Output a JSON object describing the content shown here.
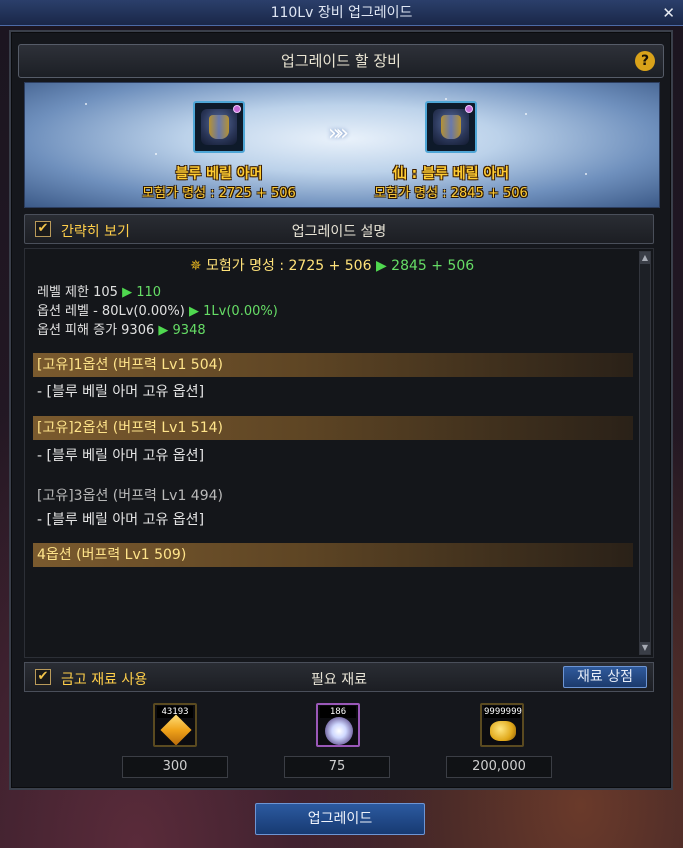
{
  "window": {
    "title": "110Lv 장비 업그레이드",
    "close_symbol": "✕"
  },
  "header": {
    "title": "업그레이드 할 장비",
    "help_symbol": "?"
  },
  "items": {
    "before": {
      "name": "블루 베릴 아머",
      "fame": "모험가 명성 : 2725 + 506"
    },
    "after": {
      "name": "仙 : 블루 베릴 아머",
      "fame": "모험가 명성 : 2845 + 506"
    },
    "arrow": "»»"
  },
  "description": {
    "checkbox_label": "간략히 보기",
    "checkbox_checked": true,
    "title": "업그레이드 설명",
    "fame_line": {
      "icon": "✵",
      "label": "모험가 명성 : 2725 + 506",
      "arrow": "▶",
      "new": "2845 + 506"
    },
    "stats": [
      {
        "label": "레벨 제한 105",
        "arrow": "▶",
        "new": "110"
      },
      {
        "label": "옵션 레벨 - 80Lv(0.00%)",
        "arrow": "▶",
        "new": "1Lv(0.00%)"
      },
      {
        "label": "옵션 피해 증가 9306",
        "arrow": "▶",
        "new": "9348"
      }
    ],
    "options": [
      {
        "title": "[고유]1옵션 (버프력 Lv1 504)",
        "sub": "- [블루 베릴 아머 고유 옵션]",
        "highlight": true
      },
      {
        "title": "[고유]2옵션 (버프력 Lv1 514)",
        "sub": "- [블루 베릴 아머 고유 옵션]",
        "highlight": true
      },
      {
        "title": "[고유]3옵션 (버프력 Lv1 494)",
        "sub": "- [블루 베릴 아머 고유 옵션]",
        "highlight": false
      },
      {
        "title": "4옵션 (버프력 Lv1 509)",
        "sub": "",
        "highlight": true
      }
    ]
  },
  "materials": {
    "checkbox_label": "금고 재료 사용",
    "checkbox_checked": true,
    "title": "필요 재료",
    "shop_label": "재료 상점",
    "list": [
      {
        "icon": "gem-icon",
        "stock": "43193",
        "required": "300"
      },
      {
        "icon": "orb-icon",
        "stock": "186",
        "required": "75"
      },
      {
        "icon": "gold-icon",
        "stock": "9999999",
        "required": "200,000"
      }
    ]
  },
  "action": {
    "upgrade_label": "업그레이드"
  }
}
